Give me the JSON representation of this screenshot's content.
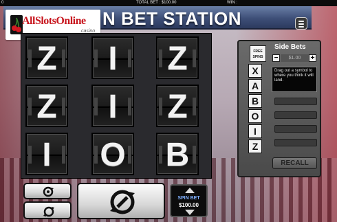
{
  "topbar": {
    "left": "0",
    "total_bet": "TOTAL BET : $100.00",
    "win": "WIN :"
  },
  "header": {
    "title": "N BET STATION"
  },
  "logo": {
    "name": "AllSlotsOnline",
    "sub": ".casino"
  },
  "reels": [
    [
      "Z",
      "I",
      "Z"
    ],
    [
      "Z",
      "I",
      "Z"
    ],
    [
      "I",
      "O",
      "B"
    ]
  ],
  "controls": {
    "spin_bet_label": "SPIN BET",
    "spin_bet_value": "$100.00"
  },
  "side_bets": {
    "free_spins_label": "FREE SPINS",
    "title": "Side Bets",
    "minus": "−",
    "plus": "+",
    "bet_value": "$1.00",
    "letters": [
      "X",
      "A",
      "B",
      "O",
      "I",
      "Z"
    ],
    "instructions": "Drag out a symbol to where you think it will land.",
    "recall_label": "RECALL"
  },
  "colors": {
    "header_blue": "#3e4f78",
    "reel_bg": "#1c1c1c",
    "logo_red": "#c8171f"
  }
}
